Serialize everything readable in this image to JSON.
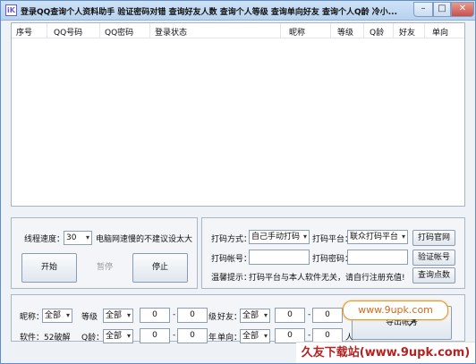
{
  "window": {
    "title": "登录QQ查询个人资料助手  验证密码对错  查询好友人数  查询个人等级  查询单向好友  查询个人Q龄  冷小...",
    "app_icon": "app-icon"
  },
  "controls": {
    "minimize": "–",
    "maximize": "□",
    "close": "✕"
  },
  "grid": {
    "columns": [
      "序号",
      "QQ号码",
      "QQ密码",
      "登录状态",
      "昵称",
      "等级",
      "Q龄",
      "好友",
      "单向"
    ]
  },
  "speed_panel": {
    "label": "线程速度：",
    "speed_value": "30",
    "hint": "电脑网速慢的不建议设太大",
    "start": "开始",
    "pause": "暂停",
    "stop": "停止"
  },
  "captcha_panel": {
    "mode_label": "打码方式：",
    "mode_value": "自己手动打码",
    "platform_label": "打码平台：",
    "platform_value": "联众打码平台",
    "site_button": "打码官网",
    "account_label": "打码帐号：",
    "password_label": "打码密码：",
    "verify_button": "验证帐号",
    "tip_label": "温馨提示：",
    "tip_text": "打码平台与本人软件无关，请自行注册充值!",
    "points_button": "查询点数"
  },
  "filter_panel": {
    "nickname_label": "昵称：",
    "nickname_value": "全部",
    "level_label": "等级",
    "level_value": "全部",
    "level_from": "0",
    "level_to": "0",
    "dash": "-",
    "level_unit": "级",
    "friends_label": "好友：",
    "friends_value": "全部",
    "friends_from": "0",
    "friends_to": "0",
    "software_label": "软件：52破解",
    "qage_label": "Q龄：",
    "qage_value": "全部",
    "qage_from": "0",
    "qage_to": "0",
    "qage_unit": "年",
    "oneway_label": "单向：",
    "oneway_value": "全部",
    "oneway_from": "0",
    "oneway_to": "0",
    "oneway_unit": "人",
    "export_button": "导出帐号"
  },
  "overlay": {
    "tooltip": "www.9upk.com",
    "watermark": "久友下载站(www.9upk.com)"
  }
}
